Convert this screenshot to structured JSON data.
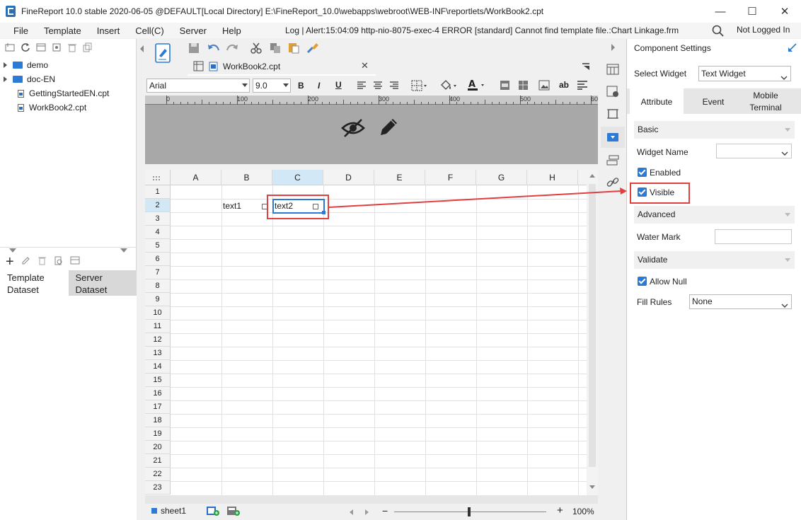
{
  "window": {
    "title": "FineReport 10.0 stable 2020-06-05 @DEFAULT[Local Directory]    E:\\FineReport_10.0\\webapps\\webroot\\WEB-INF\\reportlets/WorkBook2.cpt",
    "minimize": "—",
    "maximize": "☐",
    "close": "✕"
  },
  "menu": {
    "items": [
      "File",
      "Template",
      "Insert",
      "Cell(C)",
      "Server",
      "Help"
    ],
    "log": "Log | Alert:15:04:09 http-nio-8075-exec-4 ERROR [standard] Cannot find template file.:Chart Linkage.frm",
    "user": "Not Logged In"
  },
  "tree": {
    "items": [
      {
        "label": "demo",
        "type": "folder"
      },
      {
        "label": "doc-EN",
        "type": "folder"
      },
      {
        "label": "GettingStartedEN.cpt",
        "type": "file"
      },
      {
        "label": "WorkBook2.cpt",
        "type": "file"
      }
    ]
  },
  "dataset": {
    "template_tab": "Template Dataset",
    "server_tab": "Server Dataset"
  },
  "editor": {
    "tab": "WorkBook2.cpt",
    "font": "Arial",
    "size": "9.0",
    "ruler": [
      "0",
      "100",
      "200",
      "300",
      "400",
      "500",
      "60"
    ]
  },
  "grid": {
    "columns": [
      "A",
      "B",
      "C",
      "D",
      "E",
      "F",
      "G",
      "H"
    ],
    "rows": [
      "1",
      "2",
      "3",
      "4",
      "5",
      "6",
      "7",
      "8",
      "9",
      "10",
      "11",
      "12",
      "13",
      "14",
      "15",
      "16",
      "17",
      "18",
      "19",
      "20",
      "21",
      "22",
      "23"
    ],
    "cells": {
      "b2": "text1",
      "c2": "text2"
    }
  },
  "footer": {
    "sheet": "sheet1",
    "zoom_minus": "−",
    "zoom_plus": "+",
    "zoom": "100%"
  },
  "settings": {
    "title": "Component Settings",
    "select_widget_label": "Select Widget",
    "select_widget_value": "Text Widget",
    "tabs": [
      "Attribute",
      "Event",
      "Mobile Terminal"
    ],
    "basic": "Basic",
    "widget_name_label": "Widget Name",
    "widget_name_value": "",
    "enabled": "Enabled",
    "visible": "Visible",
    "advanced": "Advanced",
    "watermark_label": "Water Mark",
    "watermark_value": "",
    "validate": "Validate",
    "allow_null": "Allow Null",
    "fill_rules_label": "Fill Rules",
    "fill_rules_value": "None"
  },
  "colors": {
    "accent": "#2a7ad6",
    "highlight": "#e04040",
    "selected_header": "#d3e8f7"
  }
}
